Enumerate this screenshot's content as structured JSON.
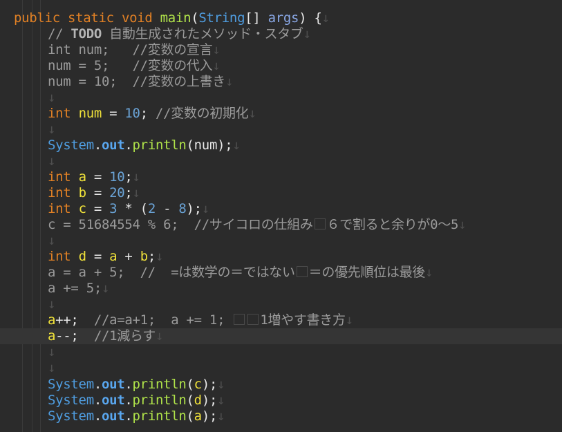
{
  "editor": {
    "eol_mark": "↓",
    "method_signature": {
      "public": "public",
      "static": "static",
      "void": "void",
      "name": "main",
      "paren_open": "(",
      "type": "String",
      "brackets": "[]",
      "param": "args",
      "close": ") {"
    },
    "todo_comment": {
      "prefix": "// ",
      "tag": "TODO",
      "text": " 自動生成されたメソッド・スタブ"
    },
    "commented_decl": "int num;   //変数の宣言",
    "commented_assign": "num = 5;   //変数の代入",
    "commented_overwrite": "num = 10;  //変数の上書き",
    "init_line": {
      "type": "int",
      "var": "num",
      "eq": " = ",
      "num": "10",
      "semi": ";",
      "comment": " //変数の初期化"
    },
    "print_num": {
      "cls": "System",
      "dot1": ".",
      "field": "out",
      "dot2": ".",
      "method": "println",
      "args": "(num);"
    },
    "decl_a": {
      "type": "int",
      "var": "a",
      "eq": " = ",
      "val": "10",
      "semi": ";"
    },
    "decl_b": {
      "type": "int",
      "var": "b",
      "eq": " = ",
      "val": "20",
      "semi": ";"
    },
    "decl_c": {
      "type": "int",
      "var": "c",
      "eq": " = ",
      "n3": "3",
      "rest1": " * (",
      "n2": "2",
      "minus": " - ",
      "n8": "8",
      "rest2": ");"
    },
    "commented_dice_a": "c = 51684554 % 6;  //サイコロの仕組み",
    "commented_dice_b": "６で割ると余りが0〜5",
    "decl_d": {
      "type": "int",
      "var": "d",
      "eq": " = ",
      "a": "a",
      "plus": " + ",
      "b": "b",
      "semi": ";"
    },
    "commented_eq_a": "a = a + 5;  //  =は数学の＝ではない",
    "commented_eq_b": "＝の優先順位は最後",
    "commented_pluseq": "a += 5;",
    "inc_line": {
      "var": "a",
      "op": "++;",
      "comment_a": "  //a=a+1;  a += 1; ",
      "comment_b": "1増やす書き方"
    },
    "dec_line": {
      "var": "a",
      "op": "--;",
      "comment": "  //1減らす"
    },
    "print_c": {
      "cls": "System",
      "dot1": ".",
      "field": "out",
      "dot2": ".",
      "method": "println",
      "open": "(",
      "arg": "c",
      "close": ");"
    },
    "print_d": {
      "cls": "System",
      "dot1": ".",
      "field": "out",
      "dot2": ".",
      "method": "println",
      "open": "(",
      "arg": "d",
      "close": ");"
    },
    "print_a": {
      "cls": "System",
      "dot1": ".",
      "field": "out",
      "dot2": ".",
      "method": "println",
      "open": "(",
      "arg": "a",
      "close": ");"
    }
  }
}
